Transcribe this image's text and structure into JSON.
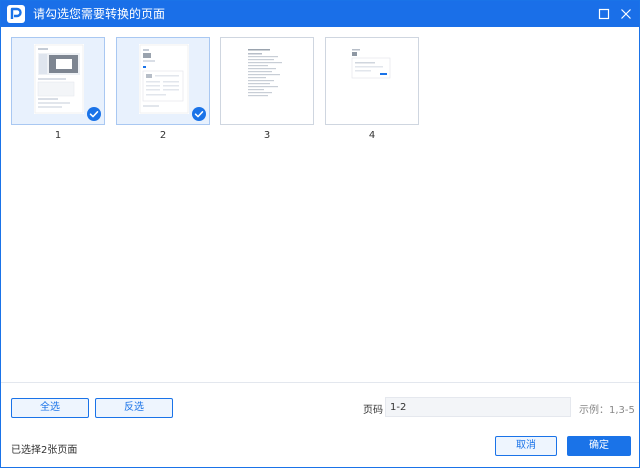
{
  "window": {
    "title": "请勾选您需要转换的页面",
    "colors": {
      "accent": "#1a73e8",
      "titlebar": "#1a6fe8"
    },
    "icons": {
      "logo": "pdf-app-logo-icon",
      "maximize": "maximize-icon",
      "close": "close-icon"
    }
  },
  "pages": [
    {
      "number": "1",
      "selected": true
    },
    {
      "number": "2",
      "selected": true
    },
    {
      "number": "3",
      "selected": false
    },
    {
      "number": "4",
      "selected": false
    }
  ],
  "toolbar": {
    "select_all": "全选",
    "invert_selection": "反选"
  },
  "page_range": {
    "label": "页码",
    "value": "1-2",
    "example": "示例：1,3-5"
  },
  "footer": {
    "selected_count": "已选择2张页面",
    "cancel": "取消",
    "ok": "确定"
  }
}
